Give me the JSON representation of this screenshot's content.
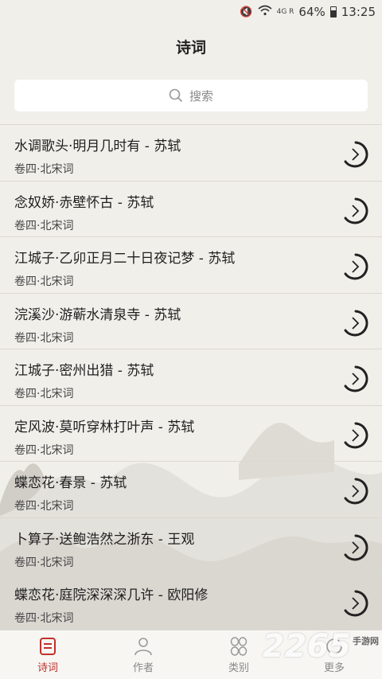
{
  "status_bar": {
    "signal_label": "4G R",
    "battery": "64%",
    "time": "13:25"
  },
  "header": {
    "title": "诗词"
  },
  "search": {
    "placeholder": "搜索"
  },
  "poems": [
    {
      "title": "水调歌头·明月几时有 - 苏轼",
      "subtitle": "卷四·北宋词"
    },
    {
      "title": "念奴娇·赤壁怀古 - 苏轼",
      "subtitle": "卷四·北宋词"
    },
    {
      "title": "江城子·乙卯正月二十日夜记梦 - 苏轼",
      "subtitle": "卷四·北宋词"
    },
    {
      "title": "浣溪沙·游蕲水清泉寺 - 苏轼",
      "subtitle": "卷四·北宋词"
    },
    {
      "title": "江城子·密州出猎 - 苏轼",
      "subtitle": "卷四·北宋词"
    },
    {
      "title": "定风波·莫听穿林打叶声 - 苏轼",
      "subtitle": "卷四·北宋词"
    },
    {
      "title": "蝶恋花·春景 - 苏轼",
      "subtitle": "卷四·北宋词"
    },
    {
      "title": "卜算子·送鲍浩然之浙东 - 王观",
      "subtitle": "卷四·北宋词"
    },
    {
      "title": "蝶恋花·庭院深深深几许 - 欧阳修",
      "subtitle": "卷四·北宋词"
    }
  ],
  "tabs": [
    {
      "label": "诗词",
      "icon": "poem-list-icon",
      "active": true
    },
    {
      "label": "作者",
      "icon": "person-icon",
      "active": false
    },
    {
      "label": "类别",
      "icon": "category-grid-icon",
      "active": false
    },
    {
      "label": "更多",
      "icon": "more-icon",
      "active": false
    }
  ],
  "watermark": {
    "brand": "2265",
    "site": "手游网"
  },
  "colors": {
    "accent": "#c0302a",
    "background": "#f1efea"
  }
}
